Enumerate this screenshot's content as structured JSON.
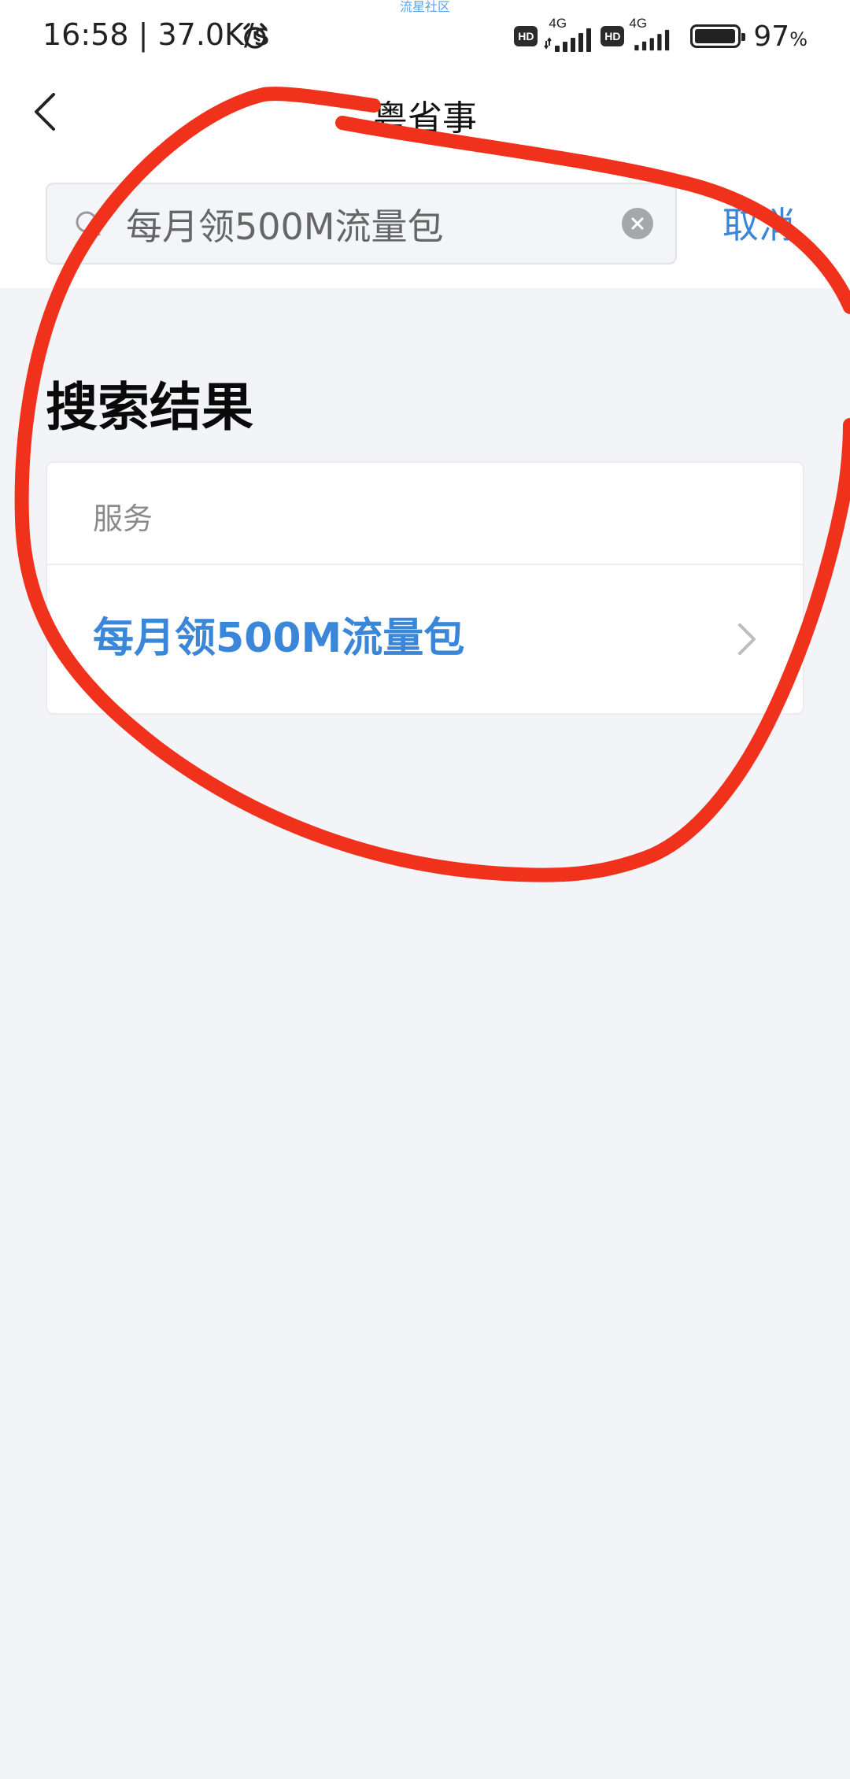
{
  "status_bar": {
    "time": "16:58 | 37.0K/s",
    "watermark": "流星社区",
    "network_1": "4G",
    "network_2": "4G",
    "hd_label": "HD",
    "battery_percent": 97,
    "battery_text": "97",
    "battery_unit": "%"
  },
  "nav": {
    "title": "粤省事"
  },
  "search": {
    "query": "每月领500M流量包",
    "cancel_label": "取消"
  },
  "results": {
    "heading": "搜索结果",
    "section_label": "服务",
    "items": [
      {
        "label": "每月领500M流量包"
      }
    ]
  },
  "colors": {
    "accent": "#3a86d9",
    "annotation": "#f0311c",
    "background": "#f3f4f8"
  }
}
